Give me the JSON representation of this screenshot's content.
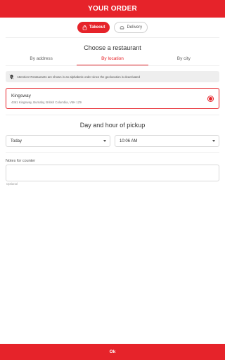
{
  "header": {
    "title": "YOUR ORDER"
  },
  "order_mode": {
    "takeout_label": "Takeout",
    "delivery_label": "Delivery"
  },
  "restaurant_section": {
    "title": "Choose a restaurant",
    "tabs": [
      {
        "label": "By address",
        "active": false
      },
      {
        "label": "By location",
        "active": true
      },
      {
        "label": "By city",
        "active": false
      }
    ],
    "notice": "Attention! Restaurants are shown in an alphabetic order since the geolocation is deactivated",
    "restaurants": [
      {
        "name": "Kingsway",
        "address": "4361 Kingsway, Burnaby, British Columbia, V5H 1Z9",
        "selected": true
      }
    ]
  },
  "pickup_section": {
    "title": "Day and hour of pickup",
    "day_value": "Today",
    "time_value": "10:06 AM"
  },
  "notes": {
    "label": "Notes for counter",
    "value": "",
    "hint": "Optional"
  },
  "footer": {
    "ok_label": "Ok"
  },
  "colors": {
    "accent": "#e6232a",
    "divider": "#eeeeee",
    "notice_bg": "#eeeeee"
  }
}
